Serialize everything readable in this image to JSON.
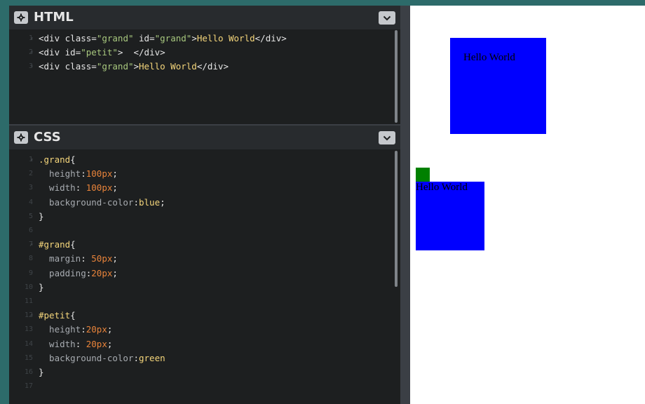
{
  "html_panel": {
    "title": "HTML",
    "lines": [
      {
        "num": "1",
        "fold": true,
        "segments": [
          [
            "t-tag",
            "<div "
          ],
          [
            "t-attr",
            "class"
          ],
          [
            "t-punct",
            "="
          ],
          [
            "t-str",
            "\"grand\""
          ],
          [
            "t-punct",
            " "
          ],
          [
            "t-attr",
            "id"
          ],
          [
            "t-punct",
            "="
          ],
          [
            "t-str",
            "\"grand\""
          ],
          [
            "t-tag",
            ">"
          ],
          [
            "t-kw",
            "Hello World"
          ],
          [
            "t-tag",
            "</div>"
          ]
        ]
      },
      {
        "num": "2",
        "fold": true,
        "segments": [
          [
            "t-tag",
            "<div "
          ],
          [
            "t-attr",
            "id"
          ],
          [
            "t-punct",
            "="
          ],
          [
            "t-str",
            "\"petit\""
          ],
          [
            "t-tag",
            ">  </div>"
          ]
        ]
      },
      {
        "num": "3",
        "fold": true,
        "segments": [
          [
            "t-tag",
            "<div "
          ],
          [
            "t-attr",
            "class"
          ],
          [
            "t-punct",
            "="
          ],
          [
            "t-str",
            "\"grand\""
          ],
          [
            "t-tag",
            ">"
          ],
          [
            "t-kw",
            "Hello World"
          ],
          [
            "t-tag",
            "</div>"
          ]
        ]
      }
    ]
  },
  "css_panel": {
    "title": "CSS",
    "lines": [
      {
        "num": "1",
        "fold": true,
        "segments": [
          [
            "t-sel",
            ".grand"
          ],
          [
            "t-brace",
            "{"
          ]
        ]
      },
      {
        "num": "2",
        "fold": false,
        "segments": [
          [
            "t-prop",
            "  height"
          ],
          [
            "t-punct",
            ":"
          ],
          [
            "t-num",
            "100px"
          ],
          [
            "t-punct",
            ";"
          ]
        ]
      },
      {
        "num": "3",
        "fold": false,
        "segments": [
          [
            "t-prop",
            "  width"
          ],
          [
            "t-punct",
            ": "
          ],
          [
            "t-num",
            "100px"
          ],
          [
            "t-punct",
            ";"
          ]
        ]
      },
      {
        "num": "4",
        "fold": false,
        "segments": [
          [
            "t-prop",
            "  background-color"
          ],
          [
            "t-punct",
            ":"
          ],
          [
            "t-kw",
            "blue"
          ],
          [
            "t-punct",
            ";"
          ]
        ]
      },
      {
        "num": "5",
        "fold": false,
        "segments": [
          [
            "t-brace",
            "}"
          ]
        ]
      },
      {
        "num": "6",
        "fold": false,
        "segments": []
      },
      {
        "num": "7",
        "fold": true,
        "segments": [
          [
            "t-sel",
            "#grand"
          ],
          [
            "t-brace",
            "{"
          ]
        ]
      },
      {
        "num": "8",
        "fold": false,
        "segments": [
          [
            "t-prop",
            "  margin"
          ],
          [
            "t-punct",
            ": "
          ],
          [
            "t-num",
            "50px"
          ],
          [
            "t-punct",
            ";"
          ]
        ]
      },
      {
        "num": "9",
        "fold": false,
        "segments": [
          [
            "t-prop",
            "  padding"
          ],
          [
            "t-punct",
            ":"
          ],
          [
            "t-num",
            "20px"
          ],
          [
            "t-punct",
            ";"
          ]
        ]
      },
      {
        "num": "10",
        "fold": false,
        "segments": [
          [
            "t-brace",
            "}"
          ]
        ]
      },
      {
        "num": "11",
        "fold": false,
        "segments": []
      },
      {
        "num": "12",
        "fold": true,
        "segments": [
          [
            "t-sel",
            "#petit"
          ],
          [
            "t-brace",
            "{"
          ]
        ]
      },
      {
        "num": "13",
        "fold": false,
        "segments": [
          [
            "t-prop",
            "  height"
          ],
          [
            "t-punct",
            ":"
          ],
          [
            "t-num",
            "20px"
          ],
          [
            "t-punct",
            ";"
          ]
        ]
      },
      {
        "num": "14",
        "fold": false,
        "segments": [
          [
            "t-prop",
            "  width"
          ],
          [
            "t-punct",
            ": "
          ],
          [
            "t-num",
            "20px"
          ],
          [
            "t-punct",
            ";"
          ]
        ]
      },
      {
        "num": "15",
        "fold": false,
        "segments": [
          [
            "t-prop",
            "  background-color"
          ],
          [
            "t-punct",
            ":"
          ],
          [
            "t-kw",
            "green"
          ]
        ]
      },
      {
        "num": "16",
        "fold": false,
        "segments": [
          [
            "t-brace",
            "}"
          ]
        ]
      },
      {
        "num": "17",
        "fold": false,
        "segments": []
      }
    ]
  },
  "preview": {
    "grand1_text": "Hello World",
    "grand2_text": "Hello World"
  },
  "icons": {
    "settings": "gear-icon",
    "collapse": "chevron-down-icon"
  },
  "colors": {
    "editor_bg": "#1d1f20",
    "header_bg": "#282b2e",
    "blue": "#0000ff",
    "green": "#008000"
  }
}
